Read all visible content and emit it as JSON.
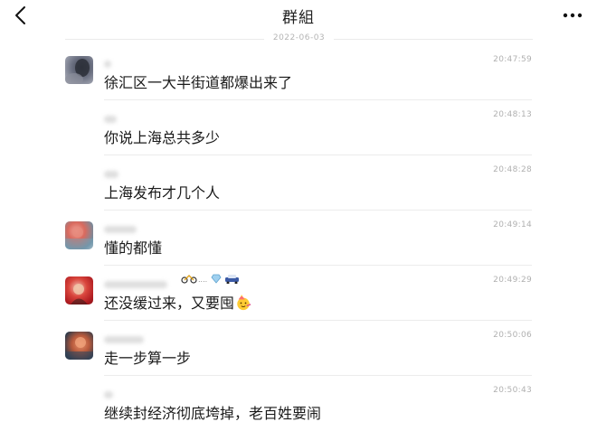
{
  "header": {
    "title": "群組"
  },
  "date_divider": "2022-06-03",
  "messages": [
    {
      "time": "20:47:59",
      "text": "徐汇区一大半街道都爆出来了"
    },
    {
      "time": "20:48:13",
      "text": "你说上海总共多少"
    },
    {
      "time": "20:48:28",
      "text": "上海发布才几个人"
    },
    {
      "time": "20:49:14",
      "text": "懂的都懂"
    },
    {
      "time": "20:49:29",
      "text": "还没缓过来，又要囤"
    },
    {
      "time": "20:50:06",
      "text": "走一步算一步"
    },
    {
      "time": "20:50:43",
      "text": "继续封经济彻底垮掉，老百姓要闹"
    }
  ],
  "icons": {
    "back": "chevron-left-icon",
    "more": "more-horizontal-icon",
    "emoji": "party-face-emoji"
  },
  "colors": {
    "background": "#ffffff",
    "text": "#1a1a1a",
    "timestamp": "#b0b0b0",
    "divider": "#ececec"
  }
}
